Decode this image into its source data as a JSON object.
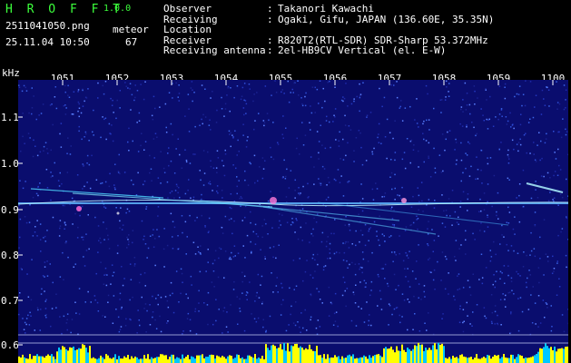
{
  "app": {
    "brand": "H R O F F T",
    "version": "1.0.0"
  },
  "file": {
    "name": "2511041050.png",
    "timestamp": "25.11.04 10:50"
  },
  "meteor": {
    "label": "meteor",
    "count": "67"
  },
  "info": [
    {
      "key": "Observer",
      "value": "Takanori Kawachi"
    },
    {
      "key": "Receiving Location",
      "value": "Ogaki, Gifu, JAPAN (136.60E, 35.35N)"
    },
    {
      "key": "Receiver",
      "value": "R820T2(RTL-SDR) SDR-Sharp 53.372MHz"
    },
    {
      "key": "Receiving antenna",
      "value": "2el-HB9CV Vertical (el. E-W)"
    }
  ],
  "axis": {
    "unit": "kHz",
    "time_ticks": [
      "1051",
      "1052",
      "1053",
      "1054",
      "1055",
      "1056",
      "1057",
      "1058",
      "1059",
      "1100"
    ],
    "freq_ticks": [
      "1.1",
      "1.0",
      "0.9",
      "0.8",
      "0.7",
      "0.6"
    ]
  },
  "colors": {
    "background": "#000000",
    "header_green": "#3cff3c",
    "text": "#ffffff",
    "spectrogram_bg": "#0a0d6e",
    "carrier": "#7fd0ff",
    "meteor_echo": "#ff6ad5",
    "bottom_yellow": "#ffff00",
    "bottom_cyan": "#00c8ff"
  }
}
